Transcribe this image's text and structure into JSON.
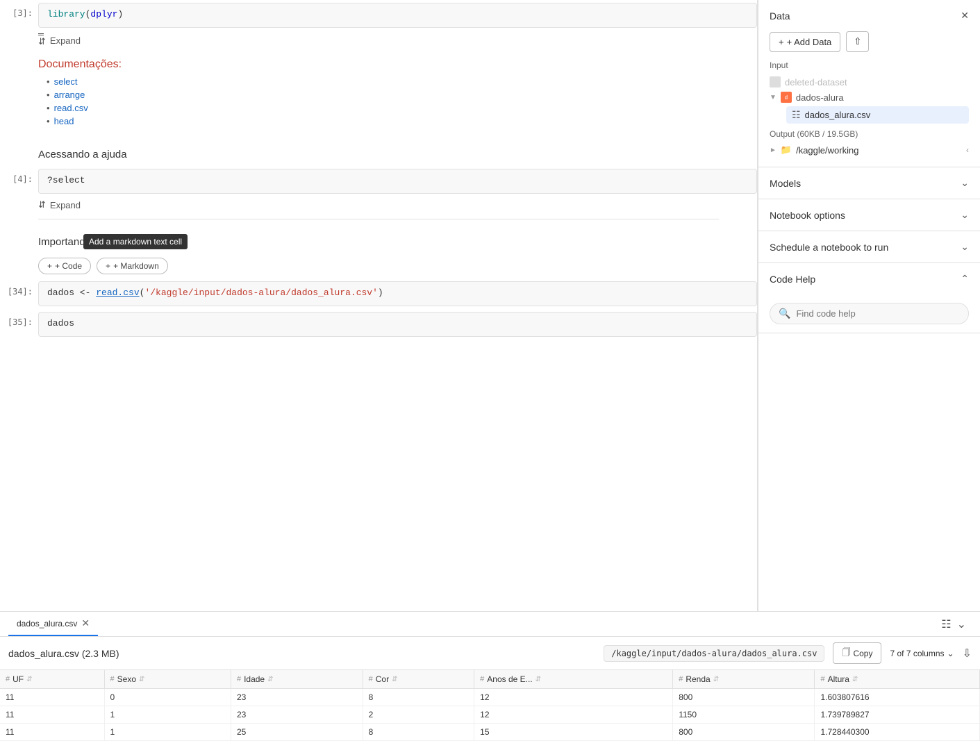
{
  "sidebar": {
    "data_section": {
      "title": "Data",
      "add_data_label": "+ Add Data",
      "input_label": "Input",
      "deleted_dataset": "deleted-dataset",
      "dados_alura": "dados-alura",
      "csv_file": "dados_alura.csv",
      "output_label": "Output (60KB / 19.5GB)",
      "working_dir": "/kaggle/working"
    },
    "models_section": {
      "title": "Models"
    },
    "notebook_options": {
      "title": "Notebook options"
    },
    "schedule_section": {
      "title": "Schedule a notebook to run"
    },
    "code_help": {
      "title": "Code Help",
      "placeholder": "Find code help"
    }
  },
  "notebook": {
    "cells": [
      {
        "number": "[3]:",
        "code": "library(dplyr)"
      },
      {
        "expand_label": "Expand"
      },
      {
        "type": "markdown",
        "doc_title": "Documentações:",
        "links": [
          "select",
          "arrange",
          "read.csv",
          "head"
        ]
      },
      {
        "type": "heading",
        "text": "Acessando a ajuda"
      },
      {
        "number": "[4]:",
        "code": "?select"
      },
      {
        "expand_label": "Expand"
      },
      {
        "type": "divider"
      },
      {
        "type": "heading",
        "text": "Importando o dataset do projeto"
      },
      {
        "type": "add_cell",
        "add_code": "+ Code",
        "add_markdown": "+ Markdown",
        "tooltip": "Add a markdown text cell"
      },
      {
        "number": "[34]:",
        "code": "dados <- read.csv('/kaggle/input/dados-alura/dados_alura.csv')"
      },
      {
        "number": "[35]:",
        "code": "dados"
      }
    ]
  },
  "data_table": {
    "tab_name": "dados_alura.csv",
    "title": "dados_alura.csv (2.3 MB)",
    "path": "/kaggle/input/dados-alura/dados_alura.csv",
    "copy_label": "Copy",
    "columns_info": "7 of 7 columns",
    "columns": [
      "UF",
      "Sexo",
      "Idade",
      "Cor",
      "Anos de E...",
      "Renda",
      "Altura"
    ],
    "rows": [
      [
        "11",
        "0",
        "23",
        "8",
        "12",
        "800",
        "1.603807616"
      ],
      [
        "11",
        "1",
        "23",
        "2",
        "12",
        "1150",
        "1.739789827"
      ],
      [
        "11",
        "1",
        "25",
        "8",
        "15",
        "800",
        "1.728440300"
      ]
    ]
  }
}
